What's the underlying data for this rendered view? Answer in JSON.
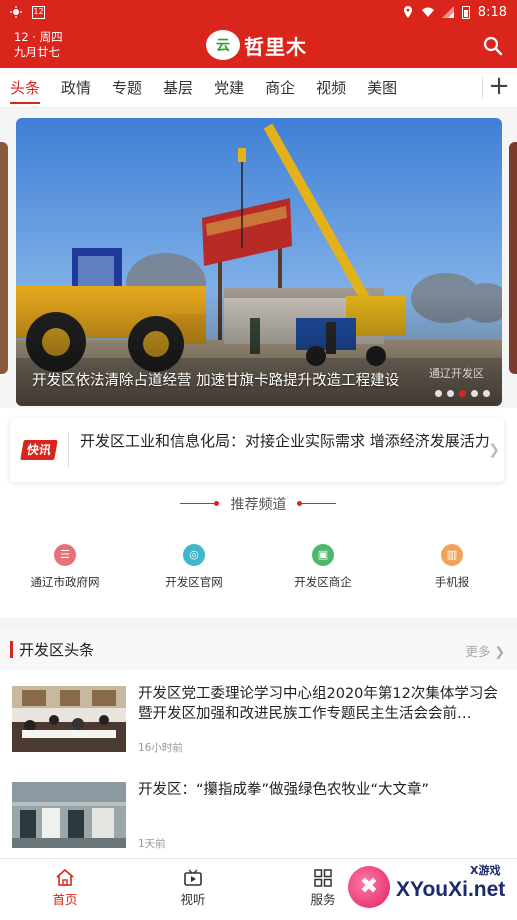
{
  "status_bar": {
    "icon_left": "sun-icon",
    "notif_badge": "12",
    "time": "8:18"
  },
  "header": {
    "date_line1": "12 · 周四",
    "date_line2": "九月廿七",
    "logo_mark": "云",
    "title": "哲里木"
  },
  "tabs": [
    "头条",
    "政情",
    "专题",
    "基层",
    "党建",
    "商企",
    "视频",
    "美图"
  ],
  "banner": {
    "caption": "开发区依法清除占道经营  加速甘旗卡路提升改造工程建设",
    "watermark": "通辽开发区",
    "dots": 5,
    "active_dot": 3
  },
  "flash": {
    "badge": "快讯",
    "text": "开发区工业和信息化局：对接企业实际需求  增添经济发展活力"
  },
  "recommend": {
    "title": "推荐频道",
    "items": [
      {
        "label": "通辽市政府网",
        "color": "#e8707a"
      },
      {
        "label": "开发区官网",
        "color": "#3fb6c9"
      },
      {
        "label": "开发区商企",
        "color": "#4cb86a"
      },
      {
        "label": "手机报",
        "color": "#f2a35a"
      }
    ]
  },
  "section": {
    "title": "开发区头条",
    "more": "更多"
  },
  "news": [
    {
      "title": "开发区党工委理论学习中心组2020年第12次集体学习会暨开发区加强和改进民族工作专题民主生活会会前…",
      "time": "16小时前"
    },
    {
      "title": "开发区：“攥指成拳”做强绿色农牧业“大文章”",
      "time": "1天前"
    }
  ],
  "bottom_nav": [
    "首页",
    "视听",
    "服务"
  ],
  "watermark_logo": {
    "text": "XYouXi.net",
    "small": "X游戏"
  },
  "colors": {
    "brand": "#d9251c"
  }
}
